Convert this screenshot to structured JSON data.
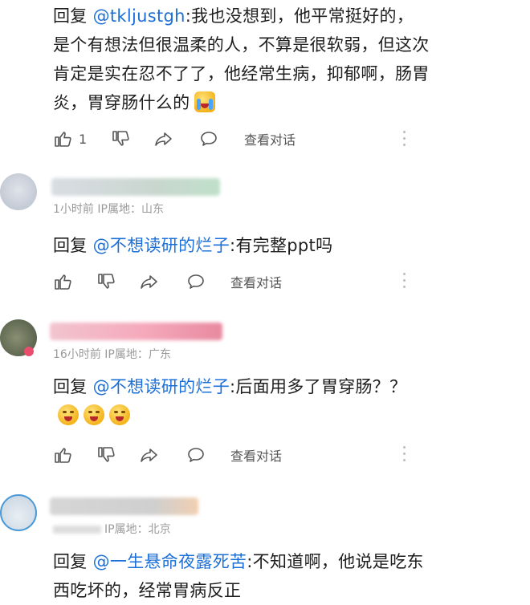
{
  "comments": [
    {
      "reply_prefix": "回复",
      "mention": "@tkljustgh",
      "text": ":我也没想到，他平常挺好的，是个有想法但很温柔的人，不算是很软弱，但这次肯定是实在忍不了了，他经常生病，抑郁啊，肠胃炎，胃穿肠什么的",
      "like_count": "1",
      "view_conversation": "查看对话"
    },
    {
      "meta_time": "1小时前",
      "meta_ip": "IP属地：山东",
      "reply_prefix": "回复",
      "mention": "@不想读研的烂子",
      "text": ":有完整ppt吗",
      "view_conversation": "查看对话"
    },
    {
      "meta_time": "16小时前",
      "meta_ip": "IP属地：广东",
      "reply_prefix": "回复",
      "mention": "@不想读研的烂子",
      "text": ":后面用多了胃穿肠？？",
      "view_conversation": "查看对话"
    },
    {
      "meta_ip": "IP属地：北京",
      "reply_prefix": "回复",
      "mention": "@一生悬命夜露死苦",
      "text": ":不知道啊，他说是吃东西吃坏的，经常胃病反正"
    }
  ],
  "icons": {
    "like": "thumbs-up-icon",
    "dislike": "thumbs-down-icon",
    "share": "share-icon",
    "comment": "comment-bubble-icon",
    "more": "more-vertical-icon"
  },
  "colors": {
    "mention": "#1d6fd8",
    "text": "#1e1e1e",
    "meta": "#9a9a9a"
  }
}
